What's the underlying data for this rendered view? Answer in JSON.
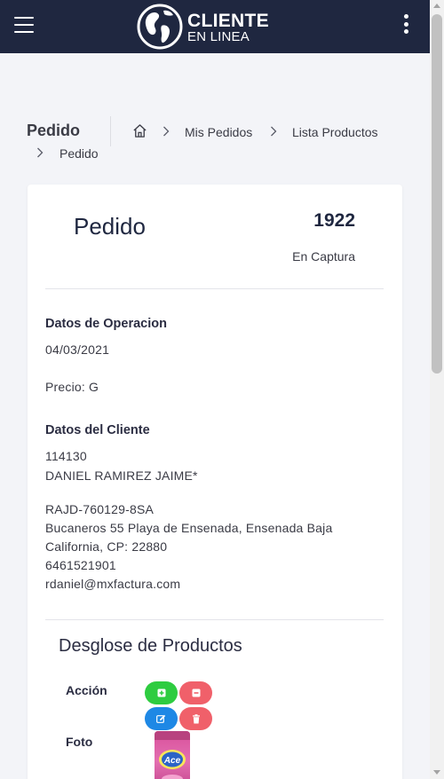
{
  "header": {
    "logo_line1": "CLIENTE",
    "logo_line2": "EN LINEA",
    "bg_color": "#1f2740",
    "menu_icon": "hamburger-menu-icon",
    "more_icon": "kebab-menu-icon"
  },
  "page": {
    "heading": "Pedido"
  },
  "breadcrumb": {
    "home_icon": "home-icon",
    "items": [
      "Mis Pedidos",
      "Lista Productos",
      "Pedido"
    ]
  },
  "order": {
    "title": "Pedido",
    "number": "1922",
    "status": "En Captura"
  },
  "operation": {
    "title": "Datos de Operacion",
    "date": "04/03/2021",
    "price": "Precio: G"
  },
  "client": {
    "title": "Datos del Cliente",
    "id": "114130",
    "name": "DANIEL RAMIREZ JAIME*",
    "rfc": "RAJD-760129-8SA",
    "address_line1": "Bucaneros 55 Playa de Ensenada, Ensenada Baja",
    "address_line2": "California, CP: 22880",
    "phone": "6461521901",
    "email": "rdaniel@mxfactura.com"
  },
  "products": {
    "title": "Desglose de Productos",
    "action_label": "Acción",
    "photo_label": "Foto",
    "product_image_text": "Ace",
    "buttons": {
      "add_icon": "plus-icon",
      "remove_icon": "minus-icon",
      "edit_icon": "edit-icon",
      "delete_icon": "trash-icon"
    },
    "colors": {
      "add": "#2ecc40",
      "remove": "#f0606a",
      "edit": "#1e88e5",
      "delete": "#f0606a"
    }
  }
}
